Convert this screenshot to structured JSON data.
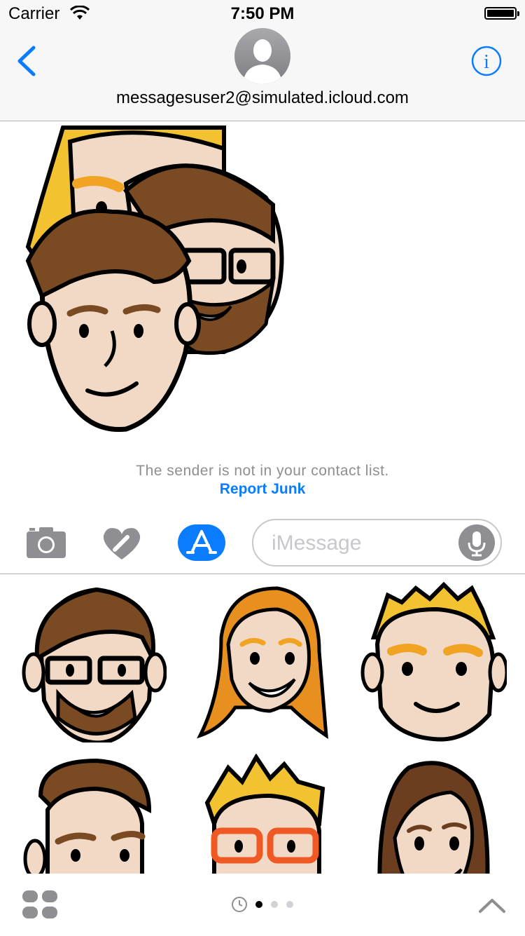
{
  "status_bar": {
    "carrier": "Carrier",
    "time": "7:50 PM"
  },
  "header": {
    "contact": "messagesuser2@simulated.icloud.com"
  },
  "notice": {
    "text": "The sender is not in your contact list.",
    "action": "Report Junk"
  },
  "input": {
    "placeholder": "iMessage"
  },
  "colors": {
    "accent": "#0a7cff",
    "gray": "#8e8e93"
  },
  "stickers": [
    "man-glasses-beard",
    "woman-orange-hair",
    "man-blonde",
    "man-brown-hair",
    "man-orange-glasses",
    "woman-brown-hair"
  ],
  "pager": {
    "pages": 3,
    "current": 1
  }
}
